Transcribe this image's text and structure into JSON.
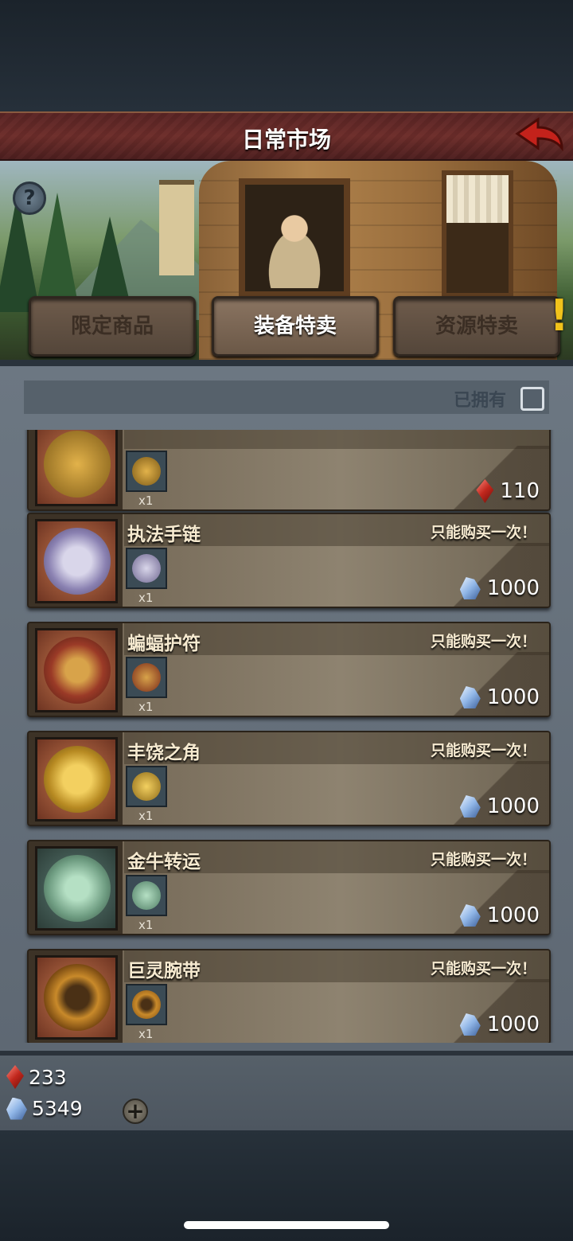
{
  "header": {
    "title": "日常市场"
  },
  "tabs": [
    {
      "label": "限定商品",
      "active": false
    },
    {
      "label": "装备特卖",
      "active": true
    },
    {
      "label": "资源特卖",
      "active": false,
      "alert": "!"
    }
  ],
  "filter": {
    "owned_label": "已拥有",
    "owned_checked": false
  },
  "items": [
    {
      "name": "",
      "buy_once": "",
      "qty": "x1",
      "price": "110",
      "currency": "red-gem",
      "icon": "golden-helmet-icon",
      "art": "#b58a2c"
    },
    {
      "name": "执法手链",
      "buy_once": "只能购买一次！",
      "qty": "x1",
      "price": "1000",
      "currency": "blue-crystal",
      "icon": "cross-bracelet-icon",
      "art": "#9a97b0"
    },
    {
      "name": "蝙蝠护符",
      "buy_once": "只能购买一次！",
      "qty": "x1",
      "price": "1000",
      "currency": "blue-crystal",
      "icon": "bat-amulet-icon",
      "art": "#8a3a2a"
    },
    {
      "name": "丰饶之角",
      "buy_once": "只能购买一次！",
      "qty": "x1",
      "price": "1000",
      "currency": "blue-crystal",
      "icon": "gold-pendant-icon",
      "art": "#c59a2a"
    },
    {
      "name": "金牛转运",
      "buy_once": "只能购买一次！",
      "qty": "x1",
      "price": "1000",
      "currency": "blue-crystal",
      "icon": "jade-bull-icon",
      "art": "#6f9d82"
    },
    {
      "name": "巨灵腕带",
      "buy_once": "只能购买一次！",
      "qty": "x1",
      "price": "1000",
      "currency": "blue-crystal",
      "icon": "golden-bracers-icon",
      "art": "#b5741e"
    }
  ],
  "wallet": {
    "red_gems": "233",
    "blue_crystals": "5349",
    "add_label": "+"
  },
  "colors": {
    "title_bar": "#6d2d2a",
    "accent_yellow": "#f1c21b"
  }
}
